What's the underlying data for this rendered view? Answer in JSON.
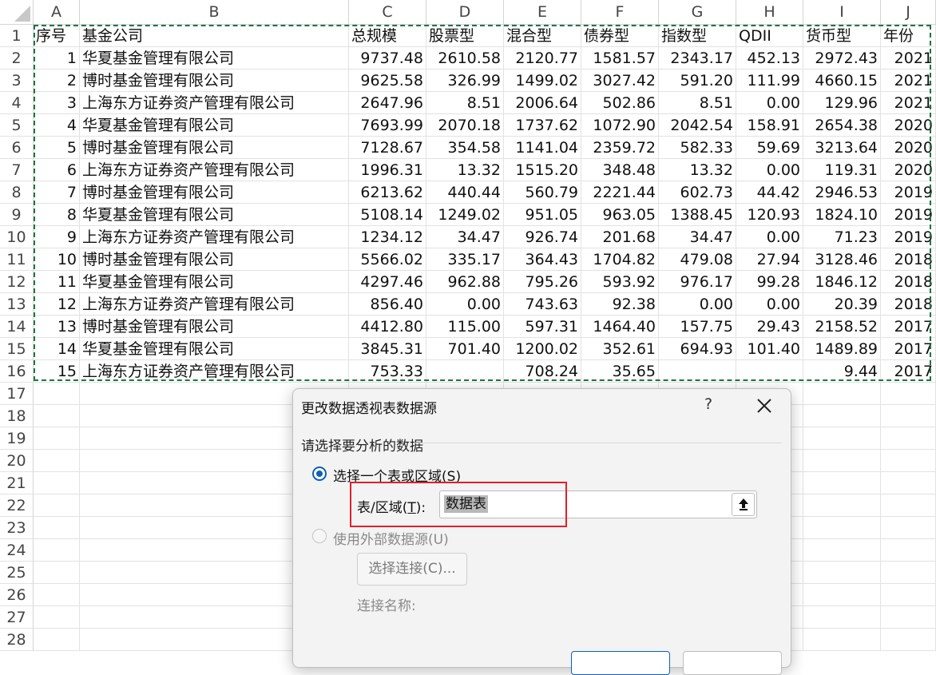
{
  "columns": [
    "A",
    "B",
    "C",
    "D",
    "E",
    "F",
    "G",
    "H",
    "I",
    "J"
  ],
  "row_numbers": [
    "1",
    "2",
    "3",
    "4",
    "5",
    "6",
    "7",
    "8",
    "9",
    "10",
    "11",
    "12",
    "13",
    "14",
    "15",
    "16",
    "17",
    "18",
    "19",
    "20",
    "21",
    "22",
    "23",
    "24",
    "25",
    "26",
    "27",
    "28"
  ],
  "header_row": [
    "序号",
    "基金公司",
    "总规模",
    "股票型",
    "混合型",
    "债券型",
    "指数型",
    "QDII",
    "货币型",
    "年份"
  ],
  "rows": [
    [
      "1",
      "华夏基金管理有限公司",
      "9737.48",
      "2610.58",
      "2120.77",
      "1581.57",
      "2343.17",
      "452.13",
      "2972.43",
      "2021"
    ],
    [
      "2",
      "博时基金管理有限公司",
      "9625.58",
      "326.99",
      "1499.02",
      "3027.42",
      "591.20",
      "111.99",
      "4660.15",
      "2021"
    ],
    [
      "3",
      "上海东方证券资产管理有限公司",
      "2647.96",
      "8.51",
      "2006.64",
      "502.86",
      "8.51",
      "0.00",
      "129.96",
      "2021"
    ],
    [
      "4",
      "华夏基金管理有限公司",
      "7693.99",
      "2070.18",
      "1737.62",
      "1072.90",
      "2042.54",
      "158.91",
      "2654.38",
      "2020"
    ],
    [
      "5",
      "博时基金管理有限公司",
      "7128.67",
      "354.58",
      "1141.04",
      "2359.72",
      "582.33",
      "59.69",
      "3213.64",
      "2020"
    ],
    [
      "6",
      "上海东方证券资产管理有限公司",
      "1996.31",
      "13.32",
      "1515.20",
      "348.48",
      "13.32",
      "0.00",
      "119.31",
      "2020"
    ],
    [
      "7",
      "博时基金管理有限公司",
      "6213.62",
      "440.44",
      "560.79",
      "2221.44",
      "602.73",
      "44.42",
      "2946.53",
      "2019"
    ],
    [
      "8",
      "华夏基金管理有限公司",
      "5108.14",
      "1249.02",
      "951.05",
      "963.05",
      "1388.45",
      "120.93",
      "1824.10",
      "2019"
    ],
    [
      "9",
      "上海东方证券资产管理有限公司",
      "1234.12",
      "34.47",
      "926.74",
      "201.68",
      "34.47",
      "0.00",
      "71.23",
      "2019"
    ],
    [
      "10",
      "博时基金管理有限公司",
      "5566.02",
      "335.17",
      "364.43",
      "1704.82",
      "479.08",
      "27.94",
      "3128.46",
      "2018"
    ],
    [
      "11",
      "华夏基金管理有限公司",
      "4297.46",
      "962.88",
      "795.26",
      "593.92",
      "976.17",
      "99.28",
      "1846.12",
      "2018"
    ],
    [
      "12",
      "上海东方证券资产管理有限公司",
      "856.40",
      "0.00",
      "743.63",
      "92.38",
      "0.00",
      "0.00",
      "20.39",
      "2018"
    ],
    [
      "13",
      "博时基金管理有限公司",
      "4412.80",
      "115.00",
      "597.31",
      "1464.40",
      "157.75",
      "29.43",
      "2158.52",
      "2017"
    ],
    [
      "14",
      "华夏基金管理有限公司",
      "3845.31",
      "701.40",
      "1200.02",
      "352.61",
      "694.93",
      "101.40",
      "1489.89",
      "2017"
    ],
    [
      "15",
      "上海东方证券资产管理有限公司",
      "753.33",
      "",
      "708.24",
      "35.65",
      "",
      "",
      "9.44",
      "2017"
    ]
  ],
  "dialog": {
    "title": "更改数据透视表数据源",
    "help": "?",
    "section_label": "请选择要分析的数据",
    "option_table": {
      "pre": "选择一个表或区域(",
      "key": "S",
      "post": ")",
      "selected": true
    },
    "table_range_label": {
      "pre": "表/区域(",
      "key": "T",
      "post": "):"
    },
    "table_range_value": "数据表",
    "option_external": {
      "label": "使用外部数据源(U)",
      "selected": false
    },
    "choose_connection_button": "选择连接(C)...",
    "connection_name_label": "连接名称:"
  },
  "icons": {
    "help": "question-icon",
    "close": "close-icon",
    "collapse": "collapse-dialog-icon"
  },
  "colors": {
    "marquee": "#217346",
    "radio_accent": "#0f5fb6",
    "highlight_box": "#e0202a"
  }
}
